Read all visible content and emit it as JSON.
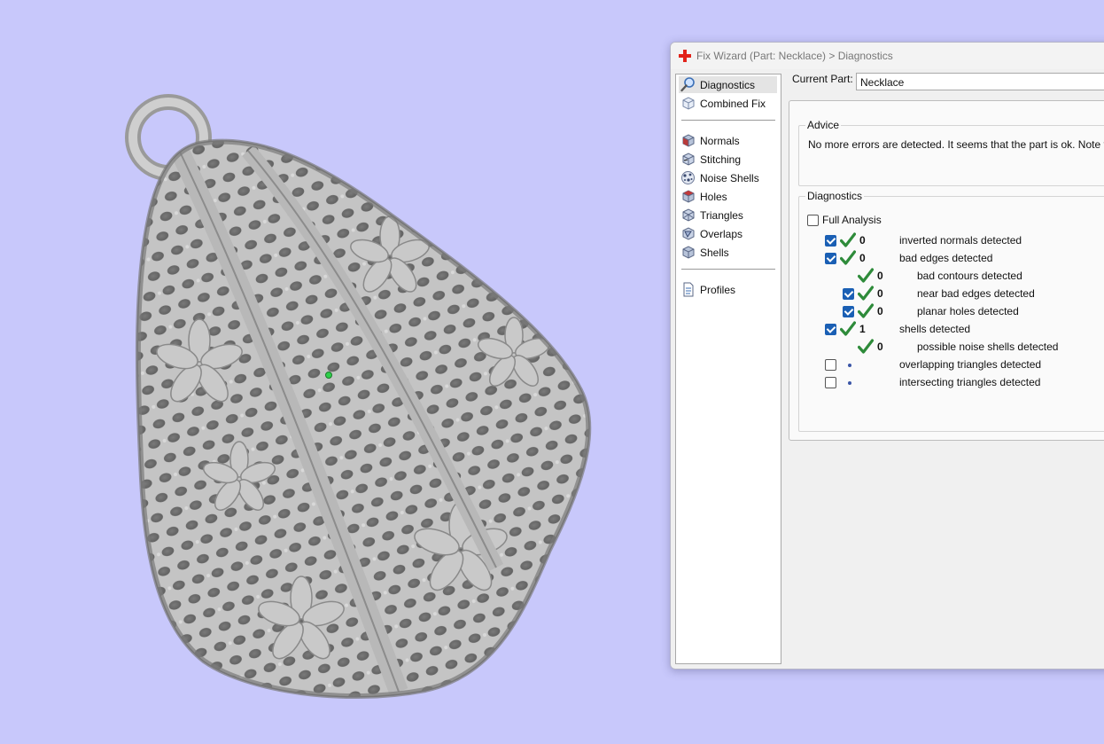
{
  "dialog": {
    "title": "Fix Wizard (Part: Necklace) > Diagnostics",
    "current_part_label": "Current Part:",
    "current_part_value": "Necklace"
  },
  "nav": {
    "items": [
      {
        "label": "Diagnostics",
        "icon": "magnifier-icon",
        "active": true
      },
      {
        "label": "Combined Fix",
        "icon": "combined-fix-cube-icon"
      },
      {
        "label": "Normals",
        "icon": "normals-cube-icon"
      },
      {
        "label": "Stitching",
        "icon": "stitching-cube-icon"
      },
      {
        "label": "Noise Shells",
        "icon": "noise-shells-icon"
      },
      {
        "label": "Holes",
        "icon": "holes-cube-icon"
      },
      {
        "label": "Triangles",
        "icon": "triangles-cube-icon"
      },
      {
        "label": "Overlaps",
        "icon": "overlaps-cube-icon"
      },
      {
        "label": "Shells",
        "icon": "shells-cube-icon"
      },
      {
        "label": "Profiles",
        "icon": "profiles-document-icon"
      }
    ]
  },
  "advice": {
    "title": "Advice",
    "text": "No more errors are detected. It seems that the part is ok. Note that r"
  },
  "diagnostics": {
    "title": "Diagnostics",
    "full_analysis_label": "Full Analysis",
    "full_analysis_checked": false,
    "rows": [
      {
        "checkbox": true,
        "checked": true,
        "status": "ok",
        "count": "0",
        "label": "inverted normals detected",
        "indent": 0
      },
      {
        "checkbox": true,
        "checked": true,
        "status": "ok",
        "count": "0",
        "label": "bad edges detected",
        "indent": 0
      },
      {
        "checkbox": false,
        "checked": false,
        "status": "ok",
        "count": "0",
        "label": "bad contours detected",
        "indent": 1
      },
      {
        "checkbox": true,
        "checked": true,
        "status": "ok",
        "count": "0",
        "label": "near bad edges detected",
        "indent": 1
      },
      {
        "checkbox": true,
        "checked": true,
        "status": "ok",
        "count": "0",
        "label": "planar holes detected",
        "indent": 1
      },
      {
        "checkbox": true,
        "checked": true,
        "status": "ok",
        "count": "1",
        "label": "shells detected",
        "indent": 0
      },
      {
        "checkbox": false,
        "checked": false,
        "status": "ok",
        "count": "0",
        "label": "possible noise shells detected",
        "indent": 1
      },
      {
        "checkbox": true,
        "checked": false,
        "status": "pending",
        "count": "",
        "label": "overlapping triangles detected",
        "indent": 0
      },
      {
        "checkbox": true,
        "checked": false,
        "status": "pending",
        "count": "",
        "label": "intersecting triangles detected",
        "indent": 0
      }
    ]
  },
  "colors": {
    "background": "#c8c8fb",
    "check_green": "#2e8b3a",
    "checkbox_blue": "#1a5fb4",
    "app_icon_red": "#e2231a"
  }
}
